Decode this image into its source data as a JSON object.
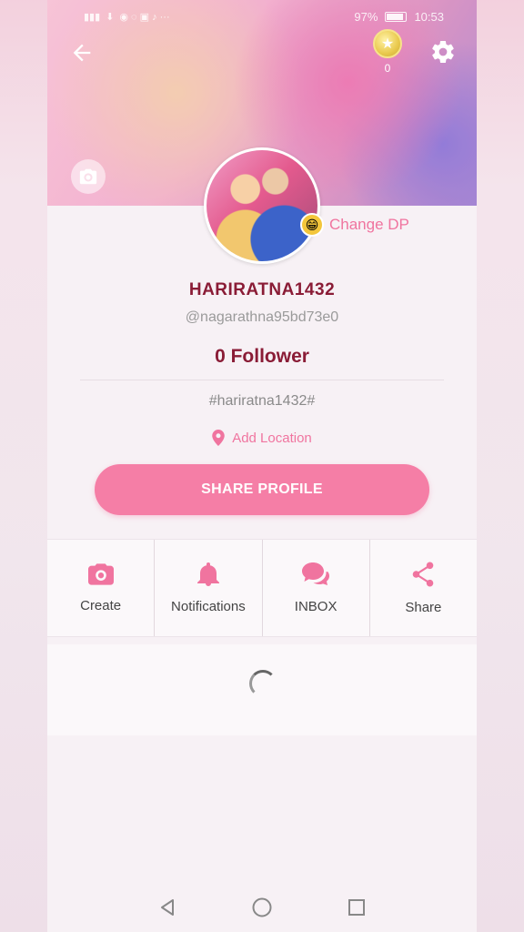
{
  "status_bar": {
    "battery": "97%",
    "time": "10:53"
  },
  "header": {
    "coins": "0"
  },
  "profile": {
    "change_dp_label": "Change DP",
    "display_name": "HARIRATNA1432",
    "handle": "@nagarathna95bd73e0",
    "followers": "0 Follower",
    "hashtag": "#hariratna1432#",
    "location_label": "Add Location",
    "share_profile_label": "SHARE PROFILE"
  },
  "actions": [
    {
      "label": "Create",
      "icon": "camera-icon"
    },
    {
      "label": "Notifications",
      "icon": "bell-icon"
    },
    {
      "label": "INBOX",
      "icon": "chat-bubbles-icon"
    },
    {
      "label": "Share",
      "icon": "share-icon"
    }
  ],
  "colors": {
    "accent": "#f57ea6",
    "name": "#8a1c36"
  }
}
